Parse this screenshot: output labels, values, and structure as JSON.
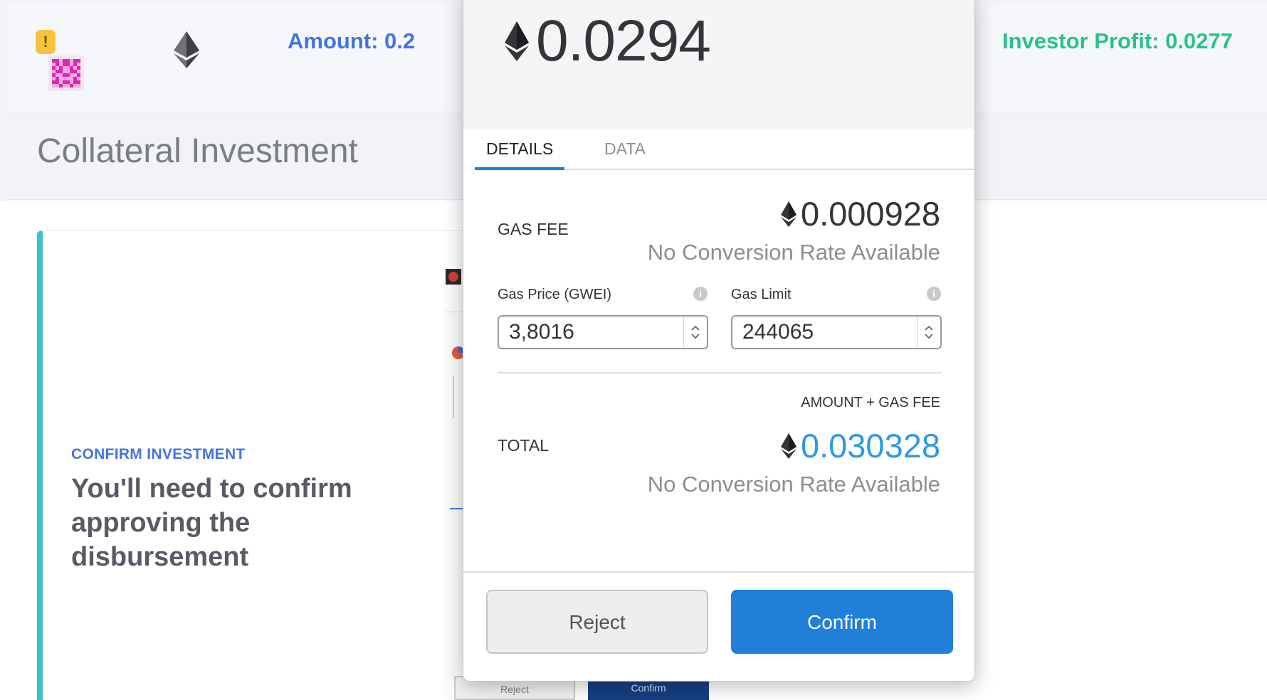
{
  "header": {
    "amount_label": "Amount: 0.2",
    "profit_label": "Investor Profit: 0.0277"
  },
  "page": {
    "title": "Collateral Investment"
  },
  "card": {
    "eyebrow": "CONFIRM INVESTMENT",
    "heading": "You'll need to confirm approving the disbursement"
  },
  "background_popup": {
    "reject_label": "Reject",
    "confirm_label": "Confirm"
  },
  "popup": {
    "hero_amount": "0.0294",
    "tabs": [
      {
        "label": "DETAILS",
        "active": true
      },
      {
        "label": "DATA",
        "active": false
      }
    ],
    "gas_fee": {
      "label": "GAS FEE",
      "value": "0.000928",
      "conversion": "No Conversion Rate Available"
    },
    "gas_price": {
      "label": "Gas Price (GWEI)",
      "value": "3,8016"
    },
    "gas_limit": {
      "label": "Gas Limit",
      "value": "244065"
    },
    "total": {
      "caption": "AMOUNT + GAS FEE",
      "label": "TOTAL",
      "value": "0.030328",
      "conversion": "No Conversion Rate Available"
    },
    "buttons": {
      "reject": "Reject",
      "confirm": "Confirm"
    }
  },
  "colors": {
    "accent_blue": "#1f7fd9",
    "total_blue": "#2f9ae0",
    "profit_green": "#27c28a",
    "amount_blue": "#4474e0",
    "card_border": "#3cc1d0"
  },
  "icons": {
    "warning": "warning-badge-icon",
    "eth": "ethereum-icon",
    "info": "info-icon",
    "stepper": "chevron-up-down-icon"
  }
}
